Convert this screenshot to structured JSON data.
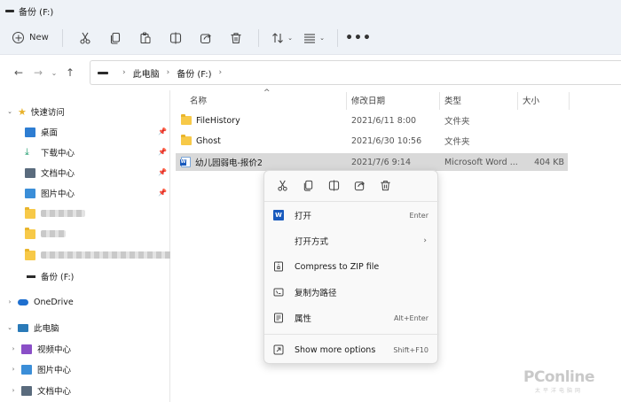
{
  "window": {
    "title": "备份 (F:)"
  },
  "toolbar": {
    "new_label": "New",
    "more_label": "•••",
    "icons": [
      "cut-icon",
      "copy-icon",
      "paste-icon",
      "rename-icon",
      "share-icon",
      "delete-icon",
      "sort-icon",
      "view-icon"
    ]
  },
  "address": {
    "crumbs": [
      "此电脑",
      "备份 (F:)"
    ]
  },
  "sidebar": {
    "quick_access": "快速访问",
    "quick_items": [
      "桌面",
      "下载中心",
      "文档中心",
      "图片中心"
    ],
    "drive": "备份 (F:)",
    "onedrive": "OneDrive",
    "this_pc": "此电脑",
    "pc_items": [
      "视频中心",
      "图片中心",
      "文档中心"
    ]
  },
  "columns": {
    "name": "名称",
    "modified": "修改日期",
    "type": "类型",
    "size": "大小"
  },
  "files": [
    {
      "name": "FileHistory",
      "modified": "2021/6/11 8:00",
      "type": "文件夹",
      "size": ""
    },
    {
      "name": "Ghost",
      "modified": "2021/6/30 10:56",
      "type": "文件夹",
      "size": ""
    },
    {
      "name": "幼儿园弱电-报价2",
      "modified": "2021/7/6 9:14",
      "type": "Microsoft Word ...",
      "size": "404 KB"
    }
  ],
  "context_menu": {
    "icons": [
      "cut-icon",
      "copy-icon",
      "rename-icon",
      "share-icon",
      "delete-icon"
    ],
    "items": [
      {
        "label": "打开",
        "shortcut": "Enter"
      },
      {
        "label": "打开方式",
        "shortcut": ""
      },
      {
        "label": "Compress to ZIP file",
        "shortcut": ""
      },
      {
        "label": "复制为路径",
        "shortcut": ""
      },
      {
        "label": "属性",
        "shortcut": "Alt+Enter"
      },
      {
        "label": "Show more options",
        "shortcut": "Shift+F10"
      }
    ]
  },
  "watermark": {
    "main": "PConline",
    "sub": "太平洋电脑网"
  },
  "colors": {
    "folder": "#f7c948",
    "word": "#185abd",
    "selected_row": "#d9d9d9",
    "toolbar_bg": "#eef2f7"
  }
}
